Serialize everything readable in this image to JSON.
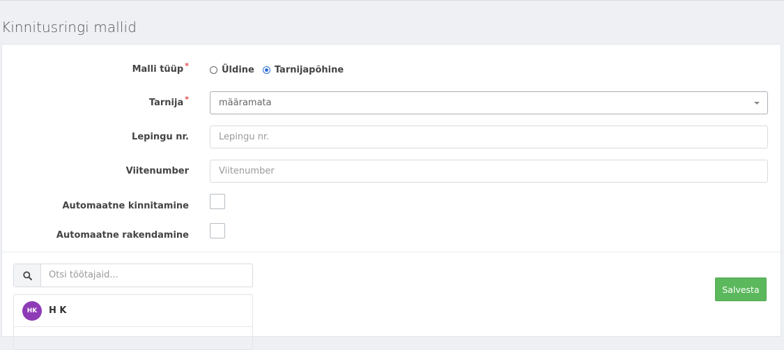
{
  "page": {
    "title": "Kinnitusringi mallid"
  },
  "form": {
    "template_type": {
      "label": "Malli tüüp",
      "required_mark": "*",
      "options": [
        {
          "label": "Üldine",
          "checked": false
        },
        {
          "label": "Tarnijapõhine",
          "checked": true
        }
      ]
    },
    "supplier": {
      "label": "Tarnija",
      "required_mark": "*",
      "value": "määramata"
    },
    "contract_no": {
      "label": "Lepingu nr.",
      "placeholder": "Lepingu nr."
    },
    "reference_no": {
      "label": "Viitenumber",
      "placeholder": "Viitenumber"
    },
    "auto_approve": {
      "label": "Automaatne kinnitamine",
      "checked": false
    },
    "auto_apply": {
      "label": "Automaatne rakendamine",
      "checked": false
    }
  },
  "employees": {
    "search_placeholder": "Otsi töötajaid...",
    "items": [
      {
        "initials": "HK",
        "name": "H K",
        "avatar_color": "#8e3bb6"
      }
    ]
  },
  "actions": {
    "save_label": "Salvesta",
    "save_color": "#5cb85c"
  }
}
